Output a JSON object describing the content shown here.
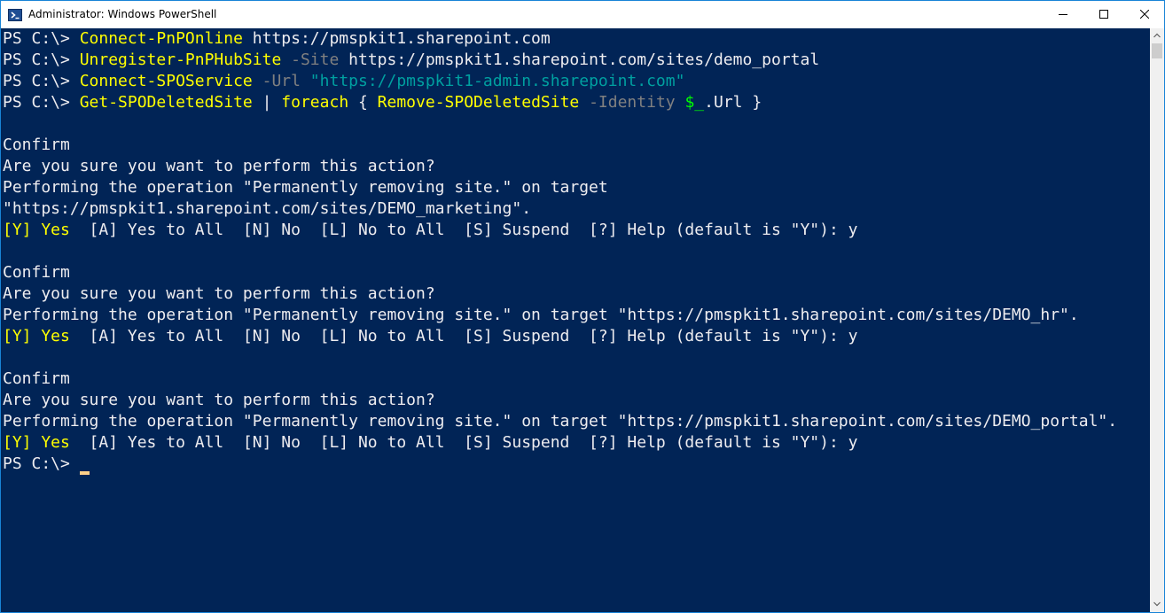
{
  "window": {
    "title": "Administrator: Windows PowerShell",
    "icon": "powershell-icon",
    "colors": {
      "background": "#012456",
      "foreground": "#eeedf0",
      "command": "#ffff00",
      "parameter": "#808080",
      "string": "#00a0a0",
      "variable": "#00ff00",
      "cursor": "#fecf89",
      "border": "#1883d7"
    }
  },
  "controls": {
    "minimize": "minimize-icon",
    "maximize": "maximize-icon",
    "close": "close-icon"
  },
  "console": {
    "prompt": "PS C:\\> ",
    "commands": [
      {
        "cmdlet": "Connect-PnPOnline",
        "rest": " https://pmspkit1.sharepoint.com"
      },
      {
        "cmdlet": "Unregister-PnPHubSite",
        "param": " -Site",
        "rest": " https://pmspkit1.sharepoint.com/sites/demo_portal"
      },
      {
        "cmdlet": "Connect-SPOService",
        "param": " -Url",
        "string": " \"https://pmspkit1-admin.sharepoint.com\""
      },
      {
        "cmdlet1": "Get-SPODeletedSite",
        "pipe": " | ",
        "cmdlet2": "foreach",
        "brace_open": " { ",
        "cmdlet3": "Remove-SPODeletedSite",
        "param": " -Identity",
        "space": " ",
        "variable": "$_",
        "tail": ".Url }"
      }
    ],
    "confirms": [
      {
        "heading": "Confirm",
        "question": "Are you sure you want to perform this action?",
        "operation_lines": [
          "Performing the operation \"Permanently removing site.\" on target",
          "\"https://pmspkit1.sharepoint.com/sites/DEMO_marketing\"."
        ],
        "yes_option": "[Y] Yes",
        "options": "  [A] Yes to All  [N] No  [L] No to All  [S] Suspend  [?] Help (default is \"Y\"): y"
      },
      {
        "heading": "Confirm",
        "question": "Are you sure you want to perform this action?",
        "operation_lines": [
          "Performing the operation \"Permanently removing site.\" on target \"https://pmspkit1.sharepoint.com/sites/DEMO_hr\"."
        ],
        "yes_option": "[Y] Yes",
        "options": "  [A] Yes to All  [N] No  [L] No to All  [S] Suspend  [?] Help (default is \"Y\"): y"
      },
      {
        "heading": "Confirm",
        "question": "Are you sure you want to perform this action?",
        "operation_lines": [
          "Performing the operation \"Permanently removing site.\" on target \"https://pmspkit1.sharepoint.com/sites/DEMO_portal\"."
        ],
        "yes_option": "[Y] Yes",
        "options": "  [A] Yes to All  [N] No  [L] No to All  [S] Suspend  [?] Help (default is \"Y\"): y"
      }
    ],
    "final_prompt": "PS C:\\> "
  }
}
